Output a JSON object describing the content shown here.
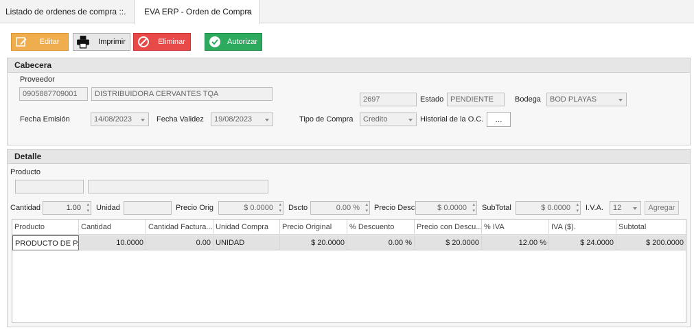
{
  "tabs": [
    {
      "label": "Listado de ordenes de compra ::."
    },
    {
      "label": "EVA ERP - Orden de Compra",
      "close": "×"
    }
  ],
  "toolbar": {
    "editar": "Editar",
    "imprimir": "Imprimir",
    "eliminar": "Eliminar",
    "autorizar": "Autorizar"
  },
  "cabecera": {
    "title": "Cabecera",
    "proveedor_label": "Proveedor",
    "proveedor_ruc": "0905887709001",
    "proveedor_nombre": "DISTRIBUIDORA CERVANTES TQA",
    "numero": "2697",
    "estado_label": "Estado",
    "estado": "PENDIENTE",
    "bodega_label": "Bodega",
    "bodega": "BOD PLAYAS",
    "fecha_emision_label": "Fecha Emisión",
    "fecha_emision": "14/08/2023",
    "fecha_validez_label": "Fecha Validez",
    "fecha_validez": "19/08/2023",
    "tipo_compra_label": "Tipo de Compra",
    "tipo_compra": "Credito",
    "historial_label": "Historial de la O.C.",
    "historial_button": "..."
  },
  "detalle": {
    "title": "Detalle",
    "producto_label": "Producto",
    "cantidad_label": "Cantidad",
    "cantidad": "1.00",
    "unidad_label": "Unidad",
    "unidad": "",
    "precio_orig_label": "Precio Orig",
    "precio_orig": "$ 0.0000",
    "dscto_label": "Dscto",
    "dscto": "0.00 %",
    "precio_desc_label": "Precio Desc",
    "precio_desc": "$ 0.0000",
    "subtotal_label": "SubTotal",
    "subtotal": "$ 0.0000",
    "iva_label": "I.V.A.",
    "iva": "12",
    "agregar": "Agregar"
  },
  "grid": {
    "columns": [
      "Producto",
      "Cantidad",
      "Cantidad Factura...",
      "Unidad Compra",
      "Precio Original",
      "% Descuento",
      "Precio con Descu...",
      "% IVA",
      "IVA ($).",
      "Subtotal"
    ],
    "rows": [
      [
        "PRODUCTO DE P...",
        "10.0000",
        "0.00",
        "UNIDAD",
        "$ 20.0000",
        "0.00 %",
        "$ 20.0000",
        "12.00 %",
        "$ 24.0000",
        "$ 200.0000"
      ]
    ]
  },
  "colors": {
    "editar": "#f0ad4e",
    "eliminar": "#e84a4a",
    "autorizar": "#2eaa5e"
  }
}
